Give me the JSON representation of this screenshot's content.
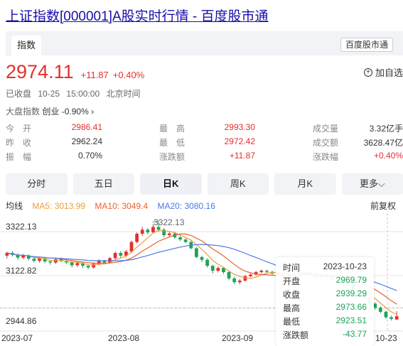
{
  "page": {
    "title": "上证指数[000001]A股实时行情 - 百度股市通"
  },
  "tabs": {
    "active": "指数",
    "brand_badge": "百度股市通"
  },
  "quote": {
    "price": "2974.11",
    "change": "+11.87",
    "change_pct": "+0.40%",
    "add_watch": "加自选"
  },
  "status": {
    "state": "已收盘",
    "date": "10-25",
    "time": "15:00:00",
    "zone": "北京时间"
  },
  "market": {
    "label": "大盘指数",
    "name": "创业",
    "value": "-0.90%",
    "arrow": "›"
  },
  "stats": {
    "open_label": "今　开",
    "open": "2986.41",
    "high_label": "最　高",
    "high": "2993.30",
    "volume_label": "成交量",
    "volume": "3.32亿手",
    "prev_label": "昨　收",
    "prev": "2962.24",
    "low_label": "最　低",
    "low": "2972.42",
    "amount_label": "成交额",
    "amount": "3628.47亿",
    "amplitude_label": "振　幅",
    "amplitude": "0.70%",
    "chg_label": "涨跌额",
    "chg": "+11.87",
    "chg_pct_label": "涨跌幅",
    "chg_pct": "+0.40%"
  },
  "periods": [
    "分时",
    "五日",
    "日K",
    "周K",
    "月K",
    "更多⌵"
  ],
  "active_period": "日K",
  "ma": {
    "label": "均线",
    "ma5": "MA5: 3013.99",
    "ma10": "MA10: 3049.4",
    "ma20": "MA20: 3080.16",
    "adjust": "前复权"
  },
  "chart_data": {
    "type": "candlestick",
    "y_labels": [
      "3322.13",
      "3122.82",
      "2944.86"
    ],
    "max_marker": "3322.13",
    "x_labels": [
      "2023-07",
      "2023-08",
      "2023-09",
      "10-23"
    ],
    "ylim": [
      2930,
      3340
    ],
    "candles": [
      [
        3195,
        3205,
        3185,
        3210
      ],
      [
        3205,
        3198,
        3192,
        3212
      ],
      [
        3198,
        3188,
        3180,
        3204
      ],
      [
        3188,
        3196,
        3182,
        3201
      ],
      [
        3196,
        3184,
        3178,
        3200
      ],
      [
        3184,
        3176,
        3170,
        3189
      ],
      [
        3176,
        3185,
        3170,
        3190
      ],
      [
        3185,
        3174,
        3168,
        3190
      ],
      [
        3174,
        3170,
        3162,
        3180
      ],
      [
        3170,
        3182,
        3165,
        3186
      ],
      [
        3182,
        3176,
        3170,
        3189
      ],
      [
        3176,
        3170,
        3164,
        3182
      ],
      [
        3170,
        3160,
        3152,
        3175
      ],
      [
        3160,
        3168,
        3154,
        3172
      ],
      [
        3168,
        3158,
        3150,
        3174
      ],
      [
        3158,
        3152,
        3146,
        3163
      ],
      [
        3152,
        3165,
        3148,
        3170
      ],
      [
        3165,
        3176,
        3160,
        3182
      ],
      [
        3176,
        3170,
        3164,
        3180
      ],
      [
        3170,
        3186,
        3166,
        3190
      ],
      [
        3186,
        3205,
        3182,
        3210
      ],
      [
        3205,
        3195,
        3188,
        3212
      ],
      [
        3195,
        3210,
        3190,
        3216
      ],
      [
        3210,
        3245,
        3205,
        3250
      ],
      [
        3245,
        3275,
        3240,
        3280
      ],
      [
        3275,
        3290,
        3268,
        3300
      ],
      [
        3290,
        3280,
        3272,
        3296
      ],
      [
        3280,
        3300,
        3276,
        3310
      ],
      [
        3300,
        3290,
        3282,
        3322
      ],
      [
        3290,
        3270,
        3262,
        3296
      ],
      [
        3270,
        3276,
        3264,
        3282
      ],
      [
        3276,
        3262,
        3256,
        3282
      ],
      [
        3262,
        3254,
        3248,
        3268
      ],
      [
        3254,
        3245,
        3240,
        3258
      ],
      [
        3245,
        3222,
        3218,
        3250
      ],
      [
        3222,
        3190,
        3186,
        3226
      ],
      [
        3190,
        3180,
        3172,
        3195
      ],
      [
        3180,
        3158,
        3152,
        3185
      ],
      [
        3158,
        3140,
        3130,
        3162
      ],
      [
        3140,
        3150,
        3134,
        3156
      ],
      [
        3150,
        3135,
        3128,
        3154
      ],
      [
        3135,
        3112,
        3105,
        3140
      ],
      [
        3112,
        3098,
        3092,
        3118
      ],
      [
        3098,
        3104,
        3090,
        3110
      ],
      [
        3104,
        3120,
        3100,
        3125
      ],
      [
        3120,
        3126,
        3116,
        3130
      ],
      [
        3126,
        3135,
        3122,
        3140
      ],
      [
        3135,
        3140,
        3130,
        3145
      ],
      [
        3140,
        3136,
        3130,
        3144
      ],
      [
        3136,
        3130,
        3124,
        3140
      ],
      [
        3130,
        3122,
        3116,
        3135
      ],
      [
        3122,
        3128,
        3118,
        3132
      ],
      [
        3128,
        3120,
        3114,
        3132
      ],
      [
        3120,
        3118,
        3112,
        3126
      ],
      [
        3118,
        3126,
        3114,
        3130
      ],
      [
        3126,
        3132,
        3122,
        3136
      ],
      [
        3132,
        3125,
        3120,
        3138
      ],
      [
        3125,
        3118,
        3112,
        3130
      ],
      [
        3118,
        3124,
        3114,
        3128
      ],
      [
        3124,
        3117,
        3112,
        3128
      ],
      [
        3117,
        3110,
        3104,
        3122
      ],
      [
        3110,
        3106,
        3100,
        3114
      ],
      [
        3106,
        3100,
        3094,
        3110
      ],
      [
        3100,
        3090,
        3084,
        3104
      ],
      [
        3090,
        3070,
        3064,
        3094
      ],
      [
        3070,
        3055,
        3050,
        3074
      ],
      [
        3055,
        3040,
        3035,
        3060
      ],
      [
        3040,
        3020,
        3014,
        3046
      ],
      [
        3020,
        3005,
        2998,
        3024
      ],
      [
        3005,
        2990,
        2985,
        3010
      ],
      [
        2990,
        2970,
        2964,
        2995
      ],
      [
        2970,
        2964,
        2958,
        2976
      ],
      [
        2962,
        2974,
        2960,
        2992
      ]
    ],
    "tooltip": {
      "time_label": "时间",
      "time": "2023-10-23",
      "open_label": "开盘",
      "open": "2969.79",
      "close_label": "收盘",
      "close": "2939.29",
      "high_label": "最高",
      "high": "2973.66",
      "low_label": "最低",
      "low": "2923.51",
      "chg_label": "涨跌额",
      "chg": "-43.77"
    },
    "colors": {
      "up": "#e62e2e",
      "down": "#1ea35a",
      "ma5": "#e8a03a",
      "ma10": "#e8602f",
      "ma20": "#4c78e8"
    }
  }
}
